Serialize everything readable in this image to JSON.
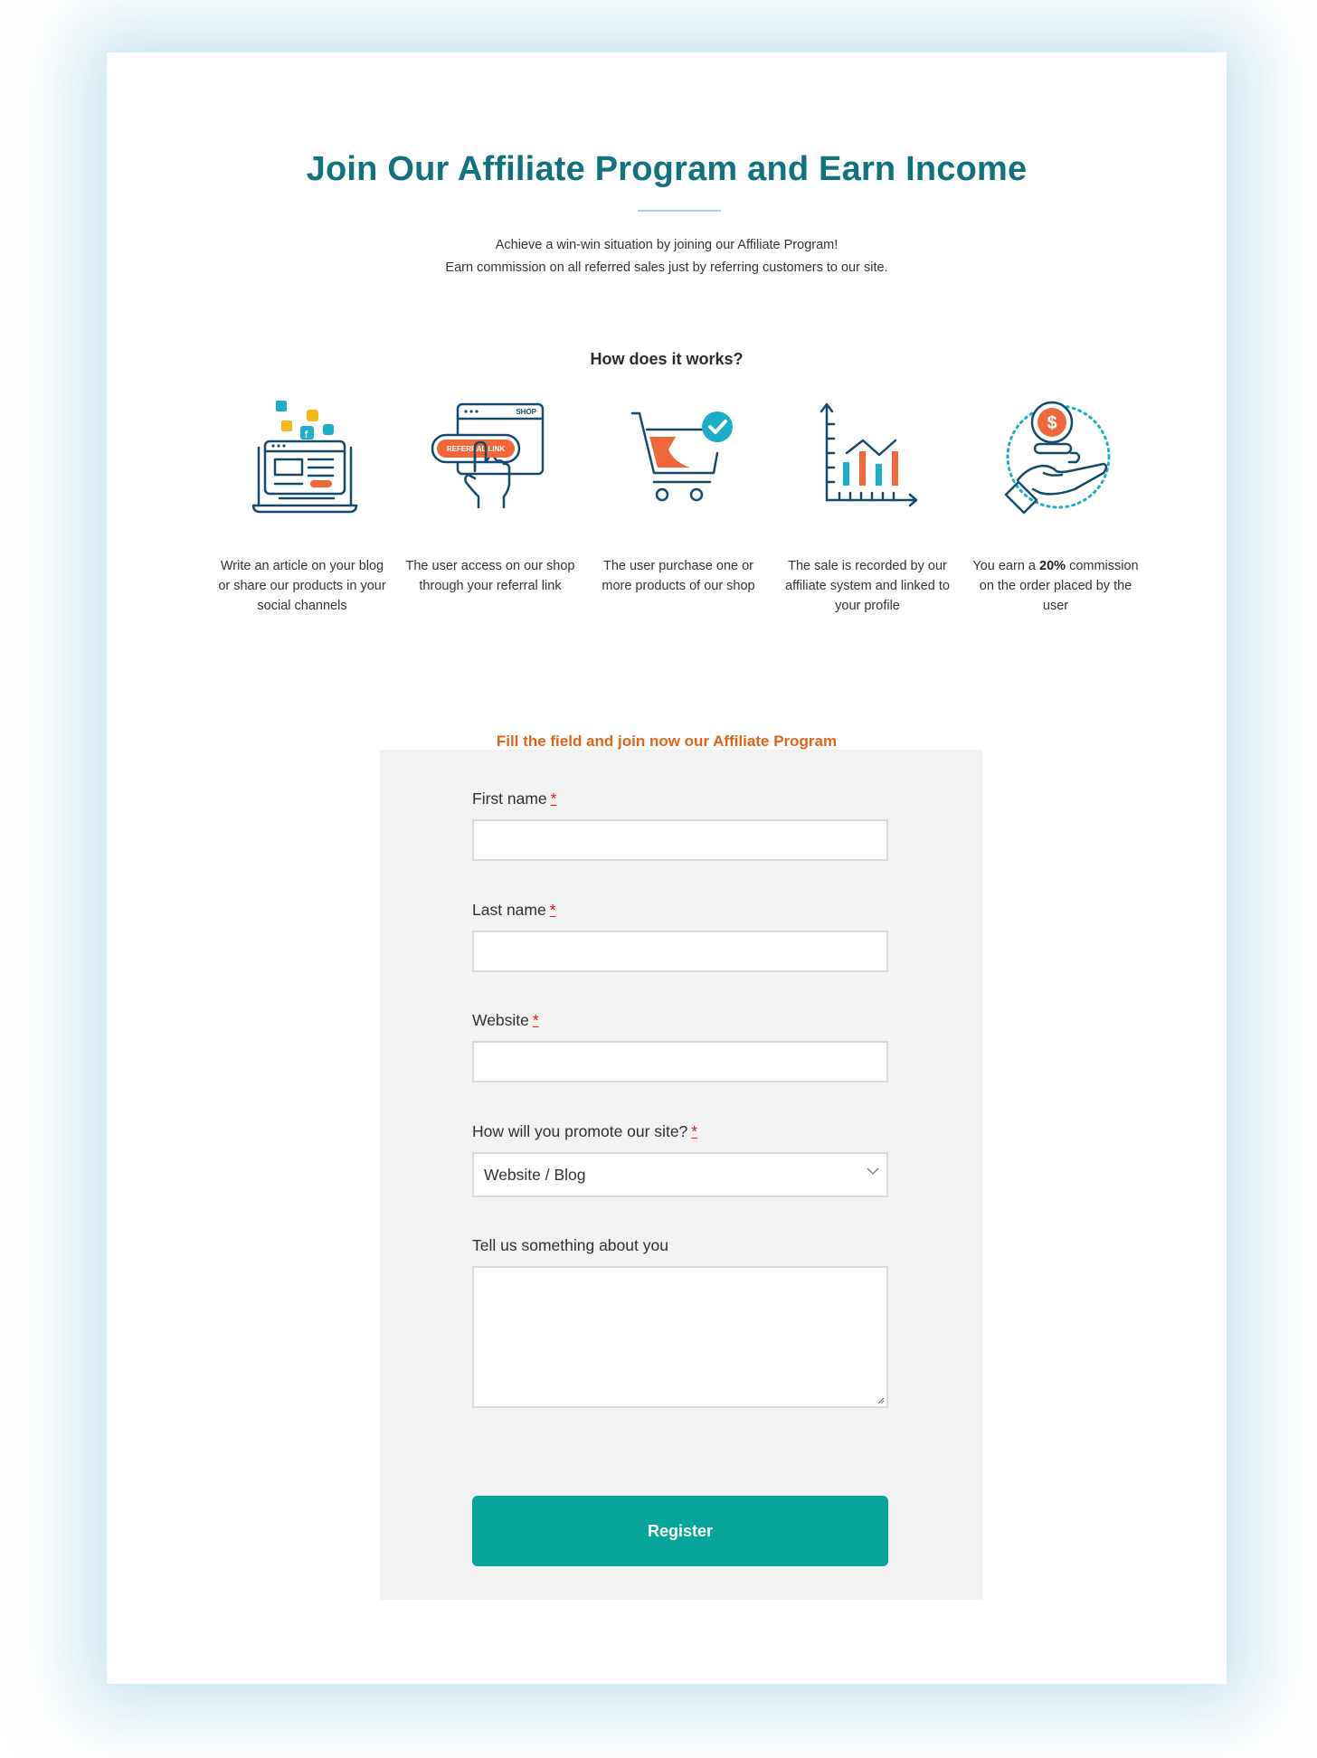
{
  "header": {
    "title": "Join Our Affiliate Program and Earn Income",
    "subtitle_line1": "Achieve a win-win situation by joining our Affiliate Program!",
    "subtitle_line2": "Earn commission on all referred sales just by referring customers to our site."
  },
  "how_it_works": {
    "heading": "How does it works?",
    "steps": [
      {
        "icon": "laptop-social-share-icon",
        "text": "Write an article on your blog or share our products in your social channels"
      },
      {
        "icon": "referral-link-click-icon",
        "text": "The user access on our shop through your referral link",
        "icon_labels": {
          "shop": "SHOP",
          "link": "REFERRAL LINK"
        }
      },
      {
        "icon": "shopping-cart-check-icon",
        "text": "The user purchase one or more products of our shop"
      },
      {
        "icon": "sales-chart-icon",
        "text": "The sale is recorded by our affiliate system and linked to your profile"
      },
      {
        "icon": "hand-coin-dollar-icon",
        "text_before": "You earn a ",
        "text_bold": "20%",
        "text_after": " commission on the order placed by the user"
      }
    ]
  },
  "form": {
    "heading": "Fill the field and join now our Affiliate Program",
    "required_mark": "*",
    "fields": {
      "first_name": {
        "label": "First name",
        "value": "",
        "required": true
      },
      "last_name": {
        "label": "Last name",
        "value": "",
        "required": true
      },
      "website": {
        "label": "Website",
        "value": "",
        "required": true
      },
      "promote": {
        "label": "How will you promote our site?",
        "selected": "Website / Blog",
        "required": true
      },
      "about": {
        "label": "Tell us something about you",
        "value": "",
        "required": false
      }
    },
    "submit_label": "Register"
  },
  "colors": {
    "title": "#11727f",
    "accent_orange": "#e0651a",
    "button": "#06a499",
    "icon_navy": "#174a6a",
    "icon_orange": "#f0673a",
    "icon_teal": "#1aaec8",
    "required": "#e01818"
  }
}
